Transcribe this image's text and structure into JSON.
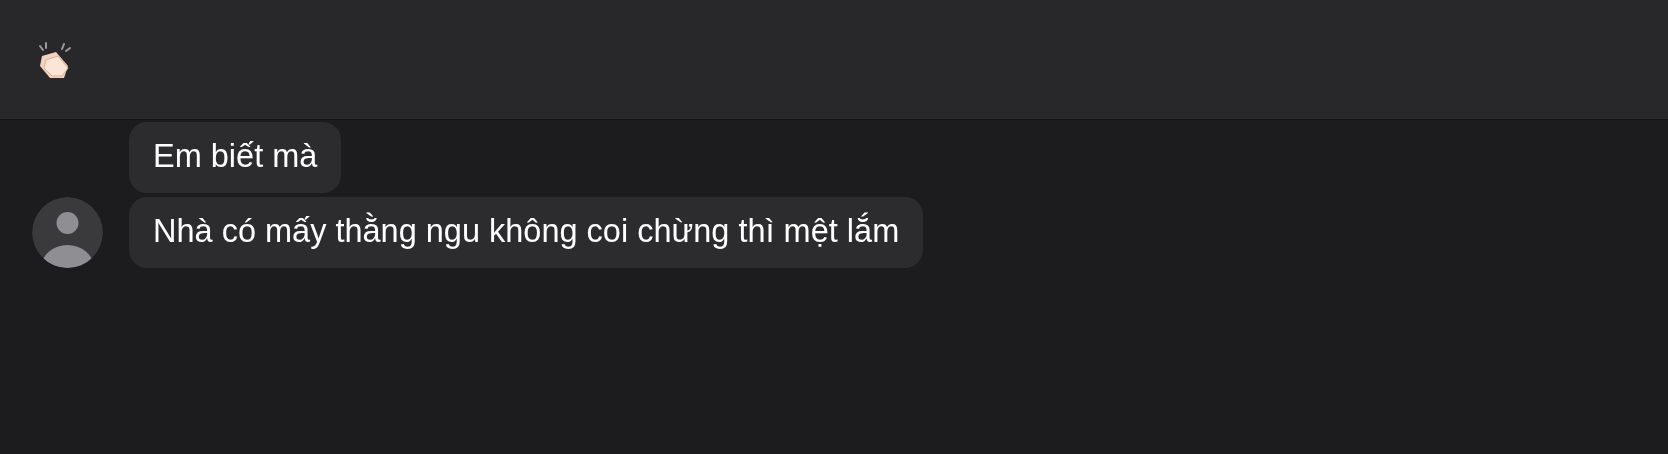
{
  "messages": [
    {
      "text": "Em biết mà",
      "show_avatar": false
    },
    {
      "text": "Nhà có mấy thằng ngu không coi chừng thì mệt lắm",
      "show_avatar": true
    }
  ]
}
